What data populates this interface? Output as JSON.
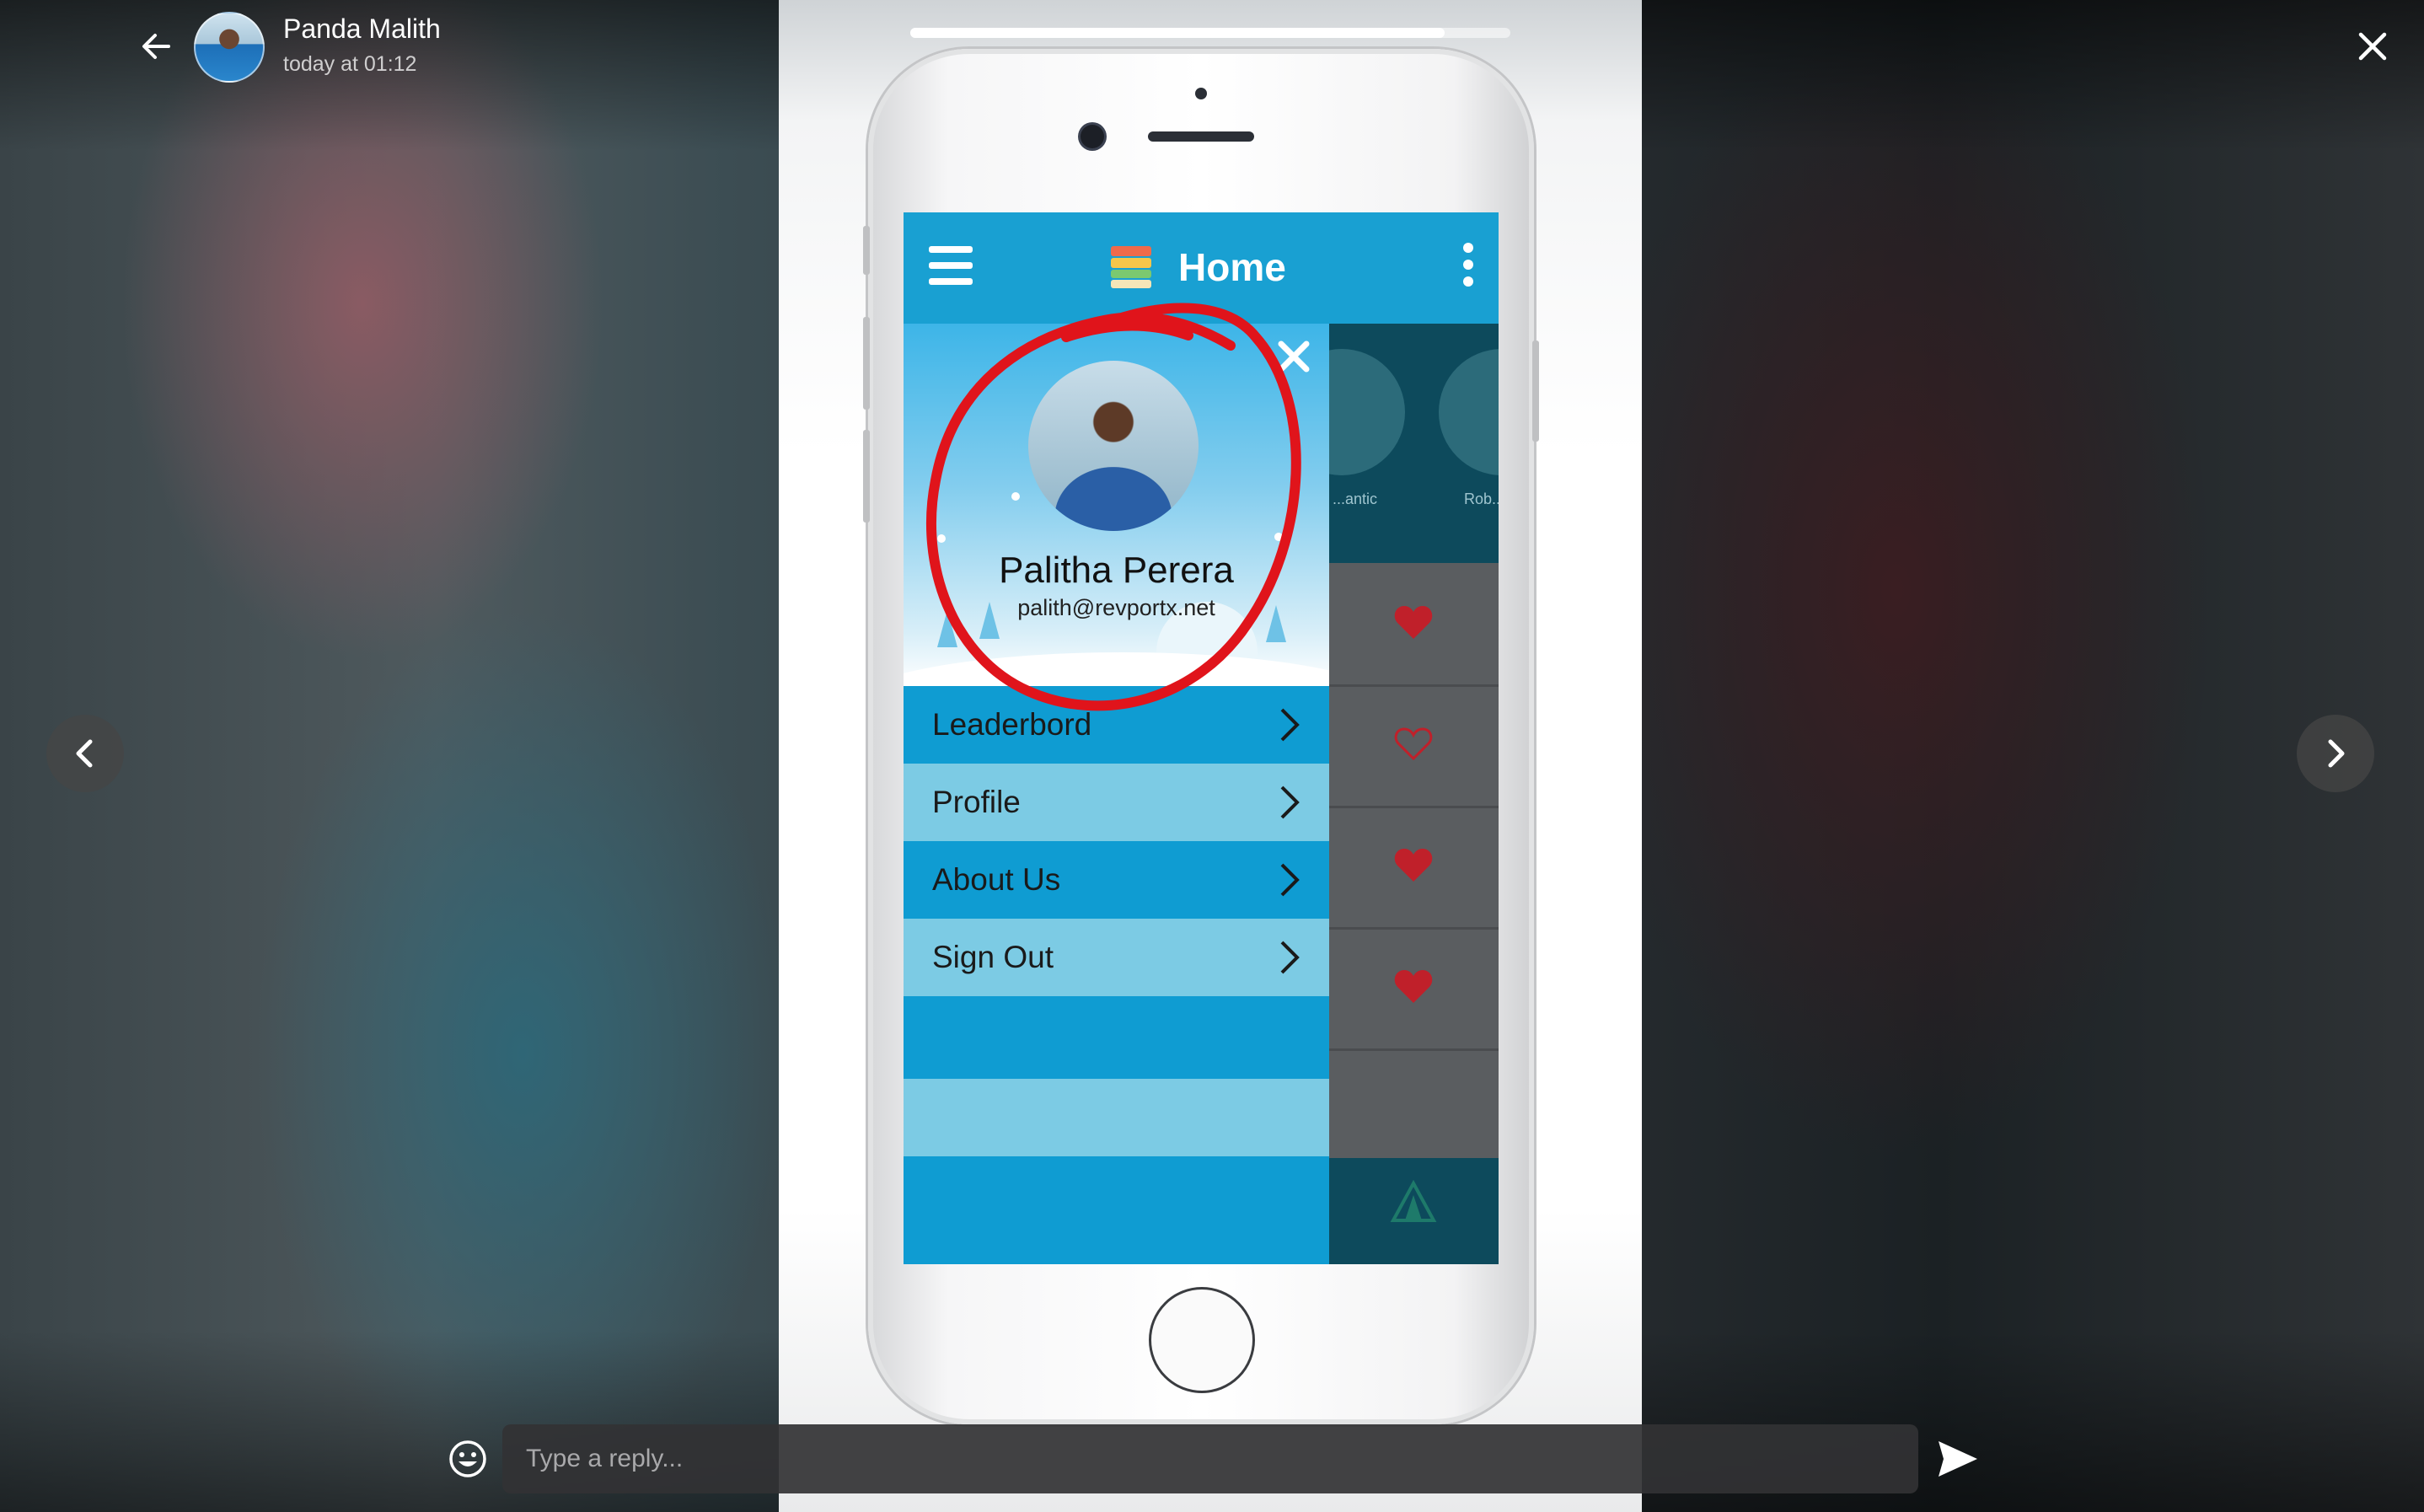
{
  "header": {
    "user_name": "Panda Malith",
    "timestamp": "today at 01:12"
  },
  "story": {
    "progress": 0.89
  },
  "phone_app": {
    "title": "Home",
    "profile": {
      "name": "Palitha Perera",
      "email": "palith@revportx.net"
    },
    "menu_items": [
      {
        "label": "Leaderbord"
      },
      {
        "label": "Profile"
      },
      {
        "label": "About Us"
      },
      {
        "label": "Sign Out"
      }
    ],
    "background_categories": [
      "...antic",
      "Rob..."
    ],
    "favorites": [
      true,
      false,
      true,
      true
    ]
  },
  "reply": {
    "placeholder": "Type a reply..."
  },
  "colors": {
    "app_blue": "#19a0d2",
    "menu_light": "#7ccbe4",
    "annotation_red": "#e0141b"
  },
  "icons": [
    "back-arrow-icon",
    "close-icon",
    "chevron-left-icon",
    "chevron-right-icon",
    "emoji-icon",
    "send-icon",
    "hamburger-icon",
    "more-vert-icon",
    "heart-icon"
  ]
}
